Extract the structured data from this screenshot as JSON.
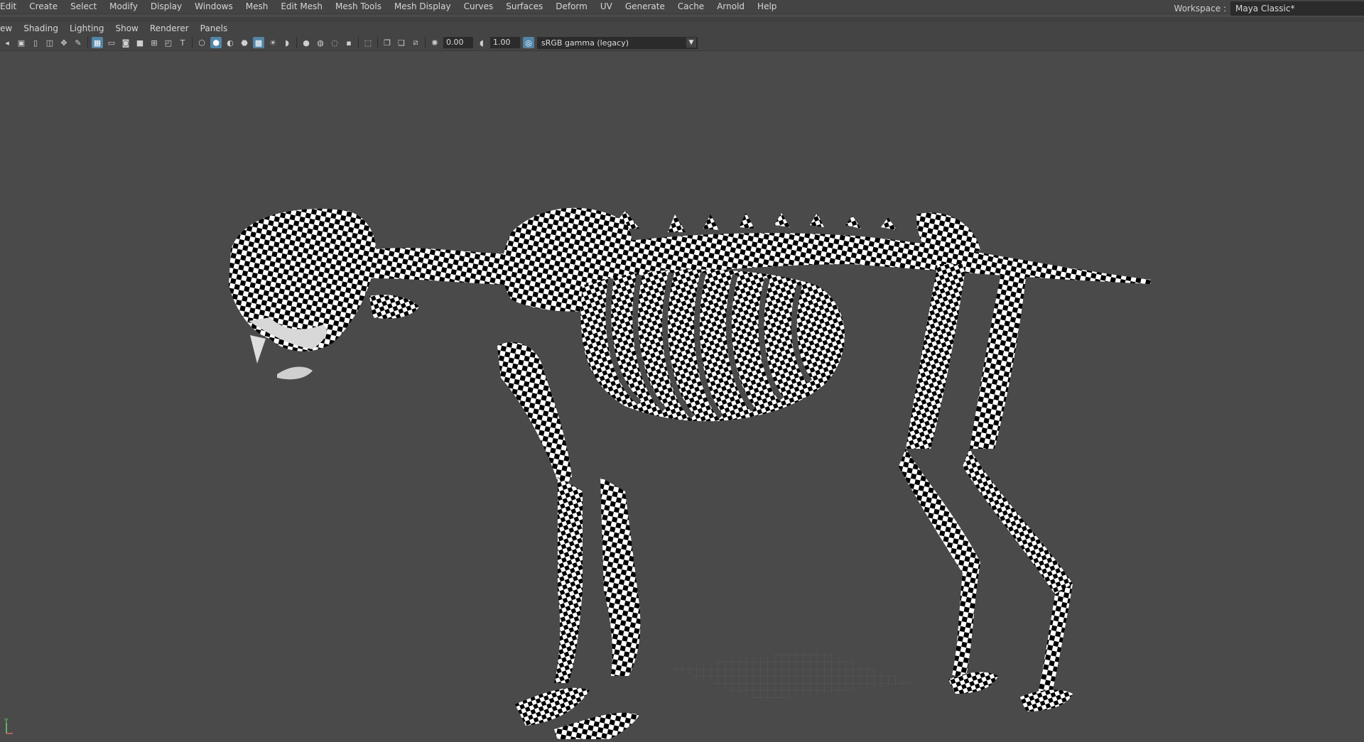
{
  "menubar": {
    "items": [
      "Edit",
      "Create",
      "Select",
      "Modify",
      "Display",
      "Windows",
      "Mesh",
      "Edit Mesh",
      "Mesh Tools",
      "Mesh Display",
      "Curves",
      "Surfaces",
      "Deform",
      "UV",
      "Generate",
      "Cache",
      "Arnold",
      "Help"
    ]
  },
  "workspace": {
    "label": "Workspace :",
    "value": "Maya Classic*"
  },
  "panel_menu": {
    "items": [
      "ew",
      "Shading",
      "Lighting",
      "Show",
      "Renderer",
      "Panels"
    ]
  },
  "toolbar": {
    "exposure": "0.00",
    "gamma": "1.00",
    "color_space": "sRGB gamma (legacy)"
  },
  "viewport": {
    "axis_label": "Y",
    "checker_colors": [
      "#000000",
      "#ffffff"
    ],
    "grid_color": "#5a5a5a"
  }
}
